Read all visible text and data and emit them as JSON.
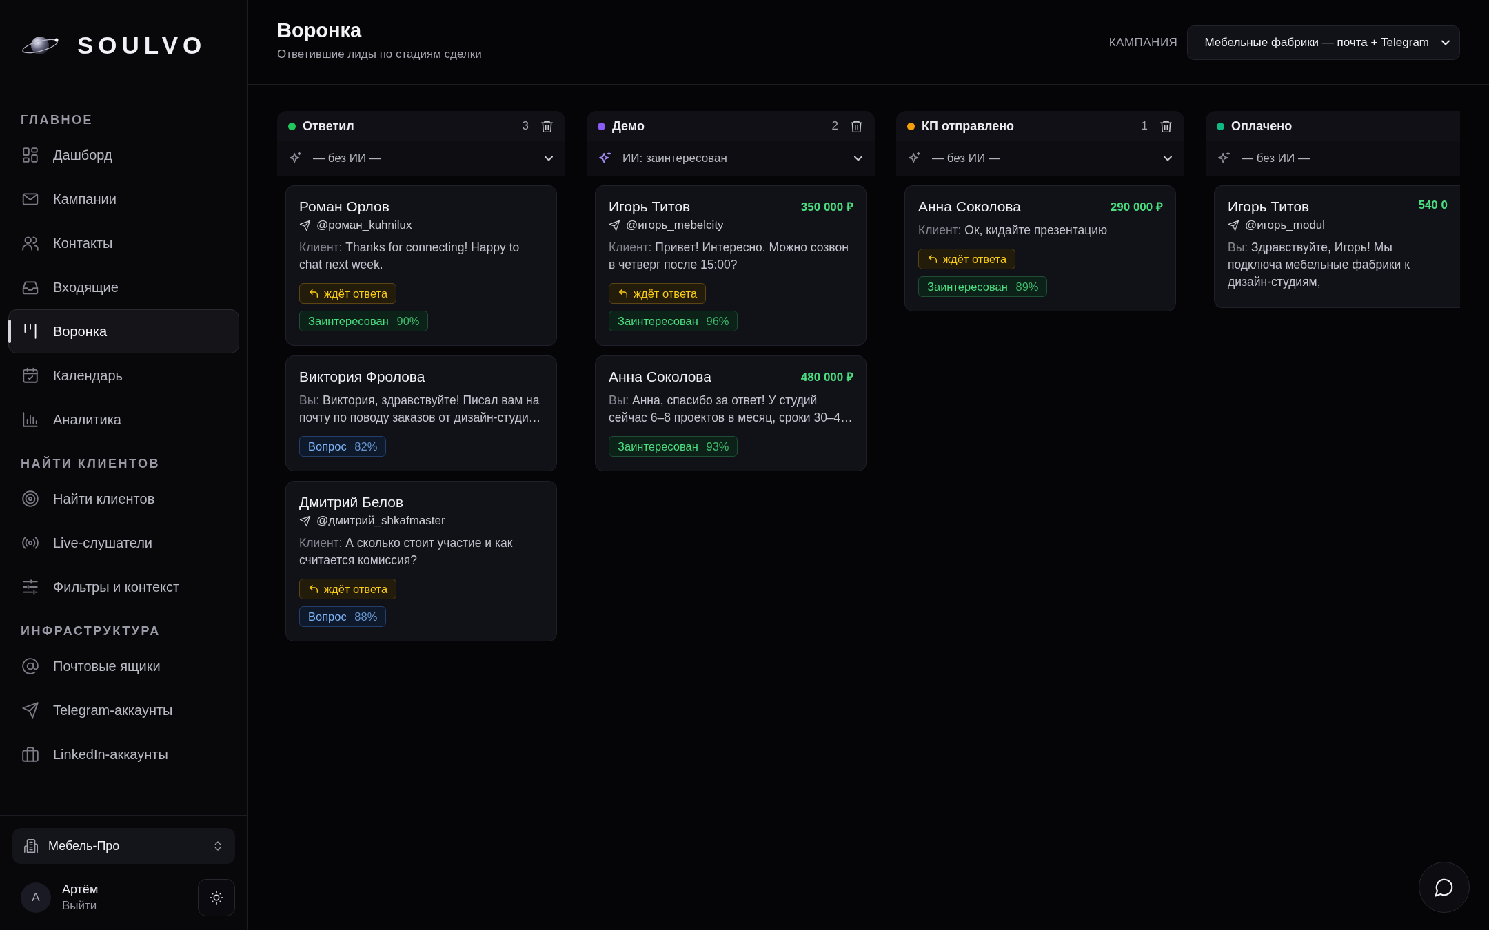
{
  "brand": {
    "name": "SOULVO"
  },
  "sidebar": {
    "sections": [
      {
        "title": "ГЛАВНОЕ",
        "items": [
          {
            "label": "Дашборд",
            "selected": false
          },
          {
            "label": "Кампании",
            "selected": false
          },
          {
            "label": "Контакты",
            "selected": false
          },
          {
            "label": "Входящие",
            "selected": false
          },
          {
            "label": "Воронка",
            "selected": true
          },
          {
            "label": "Календарь",
            "selected": false
          },
          {
            "label": "Аналитика",
            "selected": false
          }
        ]
      },
      {
        "title": "НАЙТИ КЛИЕНТОВ",
        "items": [
          {
            "label": "Найти клиентов",
            "selected": false
          },
          {
            "label": "Live-слушатели",
            "selected": false
          },
          {
            "label": "Фильтры и контекст",
            "selected": false
          }
        ]
      },
      {
        "title": "ИНФРАСТРУКТУРА",
        "items": [
          {
            "label": "Почтовые ящики",
            "selected": false
          },
          {
            "label": "Telegram-аккаунты",
            "selected": false
          },
          {
            "label": "LinkedIn-аккаунты",
            "selected": false
          }
        ]
      }
    ],
    "workspace": "Мебель-Про",
    "user": {
      "initial": "А",
      "name": "Артём",
      "logout": "Выйти"
    }
  },
  "header": {
    "title": "Воронка",
    "subtitle": "Ответившие лиды по стадиям сделки",
    "campaign_label": "КАМПАНИЯ",
    "campaign": "Мебельные фабрики — почта + Telegram"
  },
  "columns": [
    {
      "title": "Ответил",
      "color": "#22c55e",
      "count": "3",
      "ai_filter": "— без ИИ —",
      "cards": [
        {
          "name": "Роман Орлов",
          "handle": "@роман_kuhnilux",
          "message": {
            "from": "Клиент:",
            "text": "Thanks for connecting! Happy to chat next week."
          },
          "tags": [
            {
              "kind": "waiting",
              "label": "ждёт ответа"
            },
            {
              "kind": "interested",
              "label": "Заинтересован",
              "percent": "90%"
            }
          ]
        },
        {
          "name": "Виктория Фролова",
          "message": {
            "from": "Вы:",
            "text": "Виктория, здравствуйте! Писал вам на почту по поводу заказов от дизайн-студи…"
          },
          "tags": [
            {
              "kind": "question",
              "label": "Вопрос",
              "percent": "82%"
            }
          ]
        },
        {
          "name": "Дмитрий Белов",
          "handle": "@дмитрий_shkafmaster",
          "message": {
            "from": "Клиент:",
            "text": "А сколько стоит участие и как считается комиссия?"
          },
          "tags": [
            {
              "kind": "waiting",
              "label": "ждёт ответа"
            },
            {
              "kind": "question",
              "label": "Вопрос",
              "percent": "88%"
            }
          ]
        }
      ]
    },
    {
      "title": "Демо",
      "color": "#8b5cf6",
      "count": "2",
      "ai_filter": "ИИ: заинтересован",
      "cards": [
        {
          "name": "Игорь Титов",
          "amount": "350 000 ₽",
          "handle": "@игорь_mebelcity",
          "message": {
            "from": "Клиент:",
            "text": "Привет! Интересно. Можно созвон в четверг после 15:00?"
          },
          "tags": [
            {
              "kind": "waiting",
              "label": "ждёт ответа"
            },
            {
              "kind": "interested",
              "label": "Заинтересован",
              "percent": "96%"
            }
          ]
        },
        {
          "name": "Анна Соколова",
          "amount": "480 000 ₽",
          "message": {
            "from": "Вы:",
            "text": "Анна, спасибо за ответ! У студий сейчас 6–8 проектов в месяц, сроки 30–4…"
          },
          "tags": [
            {
              "kind": "interested",
              "label": "Заинтересован",
              "percent": "93%"
            }
          ]
        }
      ]
    },
    {
      "title": "КП отправлено",
      "color": "#f59e0b",
      "count": "1",
      "ai_filter": "— без ИИ —",
      "cards": [
        {
          "name": "Анна Соколова",
          "amount": "290 000 ₽",
          "message": {
            "from": "Клиент:",
            "text": "Ок, кидайте презентацию"
          },
          "tags": [
            {
              "kind": "waiting",
              "label": "ждёт ответа"
            },
            {
              "kind": "interested",
              "label": "Заинтересован",
              "percent": "89%"
            }
          ]
        }
      ]
    },
    {
      "title": "Оплачено",
      "color": "#10b981",
      "ai_filter": "— без ИИ —",
      "cards": [
        {
          "name": "Игорь Титов",
          "amount": "540 0",
          "handle": "@игорь_modul",
          "message": {
            "from": "Вы:",
            "text": "Здравствуйте, Игорь! Мы подключа мебельные фабрики к дизайн-студиям,"
          }
        }
      ]
    }
  ]
}
